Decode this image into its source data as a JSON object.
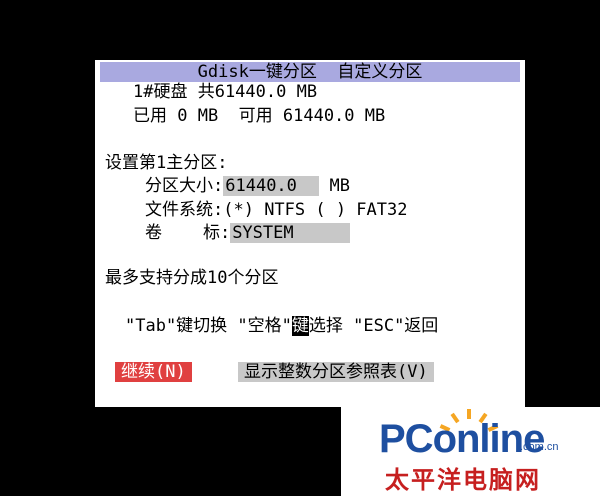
{
  "dialog": {
    "title": "Gdisk一键分区  自定义分区",
    "disk_line": "1#硬盘 共61440.0 MB",
    "usage_line": "已用 0 MB  可用 61440.0 MB",
    "section_title": "设置第1主分区:",
    "size_label": "分区大小:",
    "size_value": "61440.0",
    "size_unit": "MB",
    "fs_label": "文件系统:",
    "fs_options": "(*) NTFS ( ) FAT32",
    "volume_label": "卷    标:",
    "volume_value": "SYSTEM",
    "max_partitions": "最多支持分成10个分区",
    "hint_before": "\"Tab\"键切换 \"空格\"",
    "hint_cursor": "键",
    "hint_after": "选择 \"ESC\"返回",
    "continue_button": "继续(N)",
    "table_button": "显示整数分区参照表(V)"
  },
  "watermark": {
    "brand": "PConline",
    "domain": ".com.cn",
    "chinese_name": "太平洋电脑网"
  },
  "colors": {
    "background": "#000000",
    "title_bar": "#a9a9e0",
    "continue_button": "#e04040",
    "field_highlight": "#c8c8c8",
    "brand_blue": "#1e4fa0",
    "brand_red": "#c61f1f"
  }
}
